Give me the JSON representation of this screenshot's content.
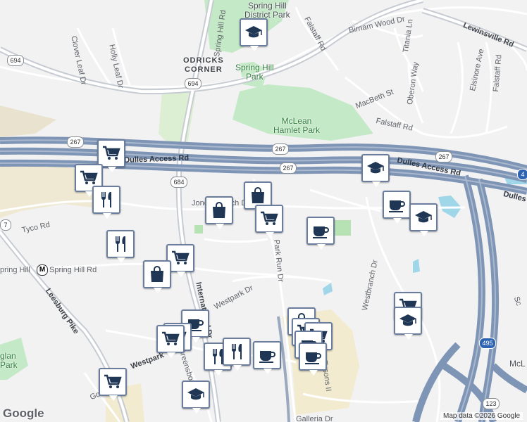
{
  "colors": {
    "background": "#f3f2f3",
    "park": "#c4e9c6",
    "water": "#9fd6e8",
    "highway": "#7f95b5",
    "pin_border": "#6a7d9d",
    "icon": "#1f3654"
  },
  "places": {
    "spring_hill_district_park": "Spring Hill\nDistrict Park",
    "odricks_corner": "ODRICKS\nCORNER",
    "spring_hill_park": "Spring Hill\nPark",
    "mclean_hamlet_park": "McLean\nHamlet Park",
    "eaglan_park": "glan\nPark",
    "mcl": "McL"
  },
  "roads": {
    "spring_hill_rd_top": "Spring Hill Rd",
    "clover_leaf": "Clover Leaf Dr",
    "holly_leaf": "Holly Leaf Dr",
    "falstaff_top": "Falstaff Rd",
    "birnam_wood": "Birnam Wood Dr",
    "titania": "Titania Ln",
    "lewinsville": "Lewinsville Rd",
    "elsinore": "Elsinore Ave",
    "falstaff_right": "Falstaff Rd",
    "macbeth": "MacBeth St",
    "oberon": "Oberon Way",
    "falstaff_mid": "Falstaff Rd",
    "dulles_left": "Dulles Access Rd",
    "dulles_right": "Dulles Access Rd",
    "dulles_far": "Dulles",
    "jones_branch": "Jones Branch Dr",
    "tyco": "Tyco Rd",
    "spring_hill_rd": "Spring Hill Rd",
    "park_run": "Park Run Dr",
    "westpark": "Westpark Dr",
    "westbranch": "Westbranch Dr",
    "international": "International Dr",
    "leesburg": "Leesburg Pike",
    "westpark_lower": "Westpark",
    "greensboro": "Greensboro Dr",
    "gosnell": "Gosnell",
    "tysons": "Tysons II",
    "galleria": "Galleria Dr",
    "sc": "Sc"
  },
  "shields": {
    "r694_top": "694",
    "r694": "694",
    "r267_a": "267",
    "r267_b": "267",
    "r267_c": "267",
    "r684": "684",
    "r7": "7",
    "r123": "123",
    "r495": "495",
    "r4": "4"
  },
  "metro": {
    "icon": "metro-icon",
    "label": "pring Hill"
  },
  "pins": [
    {
      "type": "school",
      "icon": "graduation-cap-icon"
    },
    {
      "type": "shopping",
      "icon": "shopping-cart-icon"
    },
    {
      "type": "shopping",
      "icon": "shopping-cart-icon"
    },
    {
      "type": "restaurant",
      "icon": "fork-knife-icon"
    },
    {
      "type": "shopping",
      "icon": "shopping-bag-icon"
    },
    {
      "type": "shopping",
      "icon": "shopping-bag-icon"
    },
    {
      "type": "shopping",
      "icon": "shopping-cart-icon"
    },
    {
      "type": "school",
      "icon": "graduation-cap-icon"
    },
    {
      "type": "cafe",
      "icon": "coffee-cup-icon"
    },
    {
      "type": "school",
      "icon": "graduation-cap-icon"
    },
    {
      "type": "cafe",
      "icon": "coffee-cup-icon"
    },
    {
      "type": "restaurant",
      "icon": "fork-knife-icon"
    },
    {
      "type": "shopping",
      "icon": "shopping-cart-icon"
    },
    {
      "type": "shopping",
      "icon": "shopping-bag-icon"
    },
    {
      "type": "shopping",
      "icon": "shopping-cart-icon"
    },
    {
      "type": "school",
      "icon": "graduation-cap-icon"
    },
    {
      "type": "cafe",
      "icon": "coffee-cup-icon"
    },
    {
      "type": "shopping",
      "icon": "shopping-cart-icon"
    },
    {
      "type": "shopping",
      "icon": "shopping-cart-icon"
    },
    {
      "type": "shopping",
      "icon": "shopping-bag-icon"
    },
    {
      "type": "shopping",
      "icon": "shopping-cart-icon"
    },
    {
      "type": "shopping",
      "icon": "shopping-cart-icon"
    },
    {
      "type": "cafe",
      "icon": "coffee-cup-icon"
    },
    {
      "type": "restaurant",
      "icon": "fork-knife-icon"
    },
    {
      "type": "restaurant",
      "icon": "fork-knife-icon"
    },
    {
      "type": "cafe",
      "icon": "coffee-cup-icon"
    },
    {
      "type": "shopping",
      "icon": "shopping-cart-icon"
    },
    {
      "type": "school",
      "icon": "graduation-cap-icon"
    },
    {
      "type": "cafe",
      "icon": "coffee-cup-icon"
    }
  ],
  "footer": {
    "logo": "Google",
    "attribution": "Map data ©2026 Google"
  }
}
